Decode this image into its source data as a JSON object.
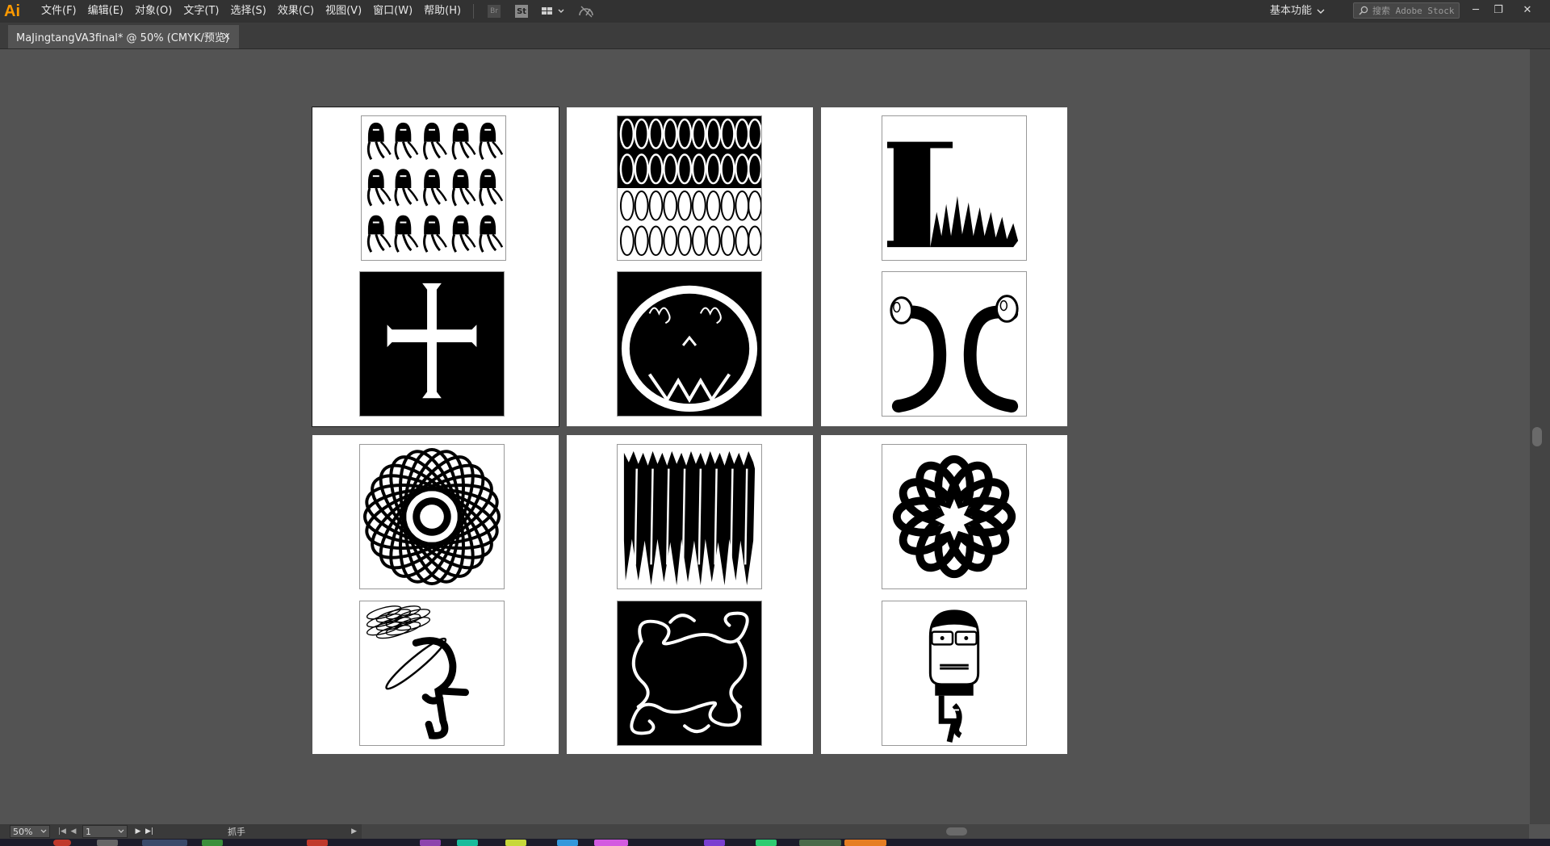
{
  "app": {
    "logo_text": "Ai",
    "accent": "#ff9a00"
  },
  "menu": {
    "items": [
      "文件(F)",
      "编辑(E)",
      "对象(O)",
      "文字(T)",
      "选择(S)",
      "效果(C)",
      "视图(V)",
      "窗口(W)",
      "帮助(H)"
    ]
  },
  "toolbar": {
    "icons": [
      "bridge-icon",
      "stock-icon",
      "arrange-documents-icon",
      "gpu-performance-icon"
    ],
    "br_label": "Br",
    "st_label": "St"
  },
  "workspace": {
    "label": "基本功能"
  },
  "search": {
    "placeholder": "搜索 Adobe Stock"
  },
  "window_controls": {
    "minimize": "─",
    "restore": "❐",
    "close": "✕"
  },
  "document_tab": {
    "title": "MaJingtangVA3final* @ 50% (CMYK/预览)",
    "close": "×"
  },
  "status": {
    "zoom": "50%",
    "page": "1",
    "tool": "抓手"
  },
  "artboards": [
    {
      "id": 1,
      "tiles": [
        "squid-pattern",
        "cross-glyph"
      ],
      "selected": true
    },
    {
      "id": 2,
      "tiles": [
        "loops-pattern",
        "face-glyph"
      ]
    },
    {
      "id": 3,
      "tiles": [
        "l-w-glyph",
        "frog-c-glyph"
      ]
    },
    {
      "id": 4,
      "tiles": [
        "spirograph",
        "scribble-figure"
      ]
    },
    {
      "id": 5,
      "tiles": [
        "zigzag-pattern",
        "curl-frame"
      ]
    },
    {
      "id": 6,
      "tiles": [
        "petal-wheel",
        "glasses-figure"
      ]
    }
  ]
}
